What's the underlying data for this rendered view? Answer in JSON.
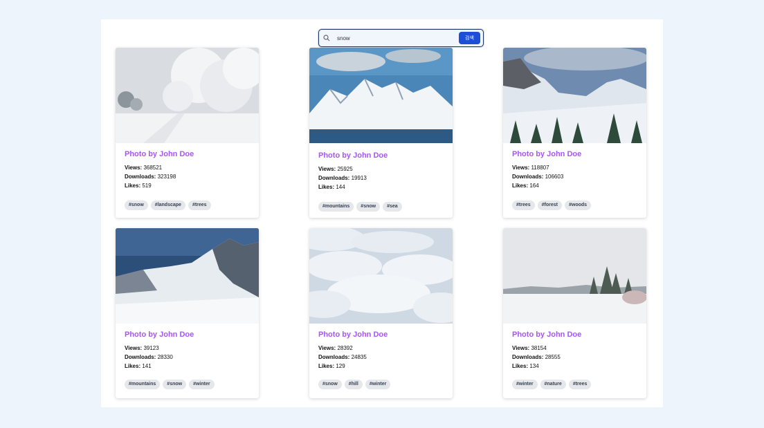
{
  "search": {
    "value": "snow",
    "button_label": "검색",
    "icon": "search-icon"
  },
  "labels": {
    "views": "Views:",
    "downloads": "Downloads:",
    "likes": "Likes:"
  },
  "cards": [
    {
      "title": "Photo by John Doe",
      "views": "368521",
      "downloads": "323198",
      "likes": "519",
      "tags": [
        "#snow",
        "#landscape",
        "#trees"
      ]
    },
    {
      "title": "Photo by John Doe",
      "views": "25925",
      "downloads": "19913",
      "likes": "144",
      "tags": [
        "#mountains",
        "#snow",
        "#sea"
      ]
    },
    {
      "title": "Photo by John Doe",
      "views": "118807",
      "downloads": "106603",
      "likes": "164",
      "tags": [
        "#trees",
        "#forest",
        "#woods"
      ]
    },
    {
      "title": "Photo by John Doe",
      "views": "39123",
      "downloads": "28330",
      "likes": "141",
      "tags": [
        "#mountains",
        "#snow",
        "#winter"
      ]
    },
    {
      "title": "Photo by John Doe",
      "views": "28392",
      "downloads": "24835",
      "likes": "129",
      "tags": [
        "#snow",
        "#hill",
        "#winter"
      ]
    },
    {
      "title": "Photo by John Doe",
      "views": "38154",
      "downloads": "28555",
      "likes": "134",
      "tags": [
        "#winter",
        "#nature",
        "#trees"
      ]
    }
  ]
}
